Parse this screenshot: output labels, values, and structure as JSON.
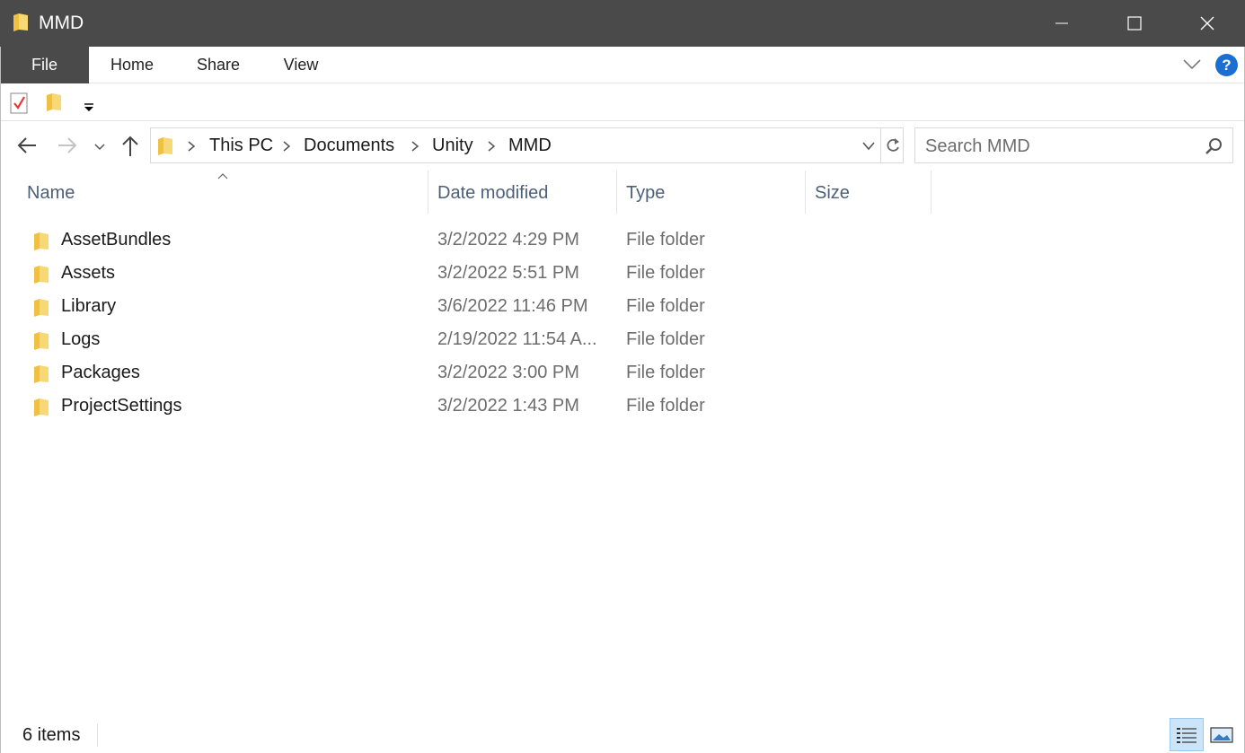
{
  "window": {
    "title": "MMD",
    "minimize_icon": "minimize-icon",
    "maximize_icon": "maximize-icon",
    "close_icon": "close-icon"
  },
  "ribbon": {
    "tabs": [
      {
        "label": "File",
        "active": true
      },
      {
        "label": "Home"
      },
      {
        "label": "Share"
      },
      {
        "label": "View"
      }
    ],
    "help_label": "?",
    "accent_color": "#1a6fd1"
  },
  "quick_access": {
    "icons": [
      "properties-icon",
      "new-folder-icon",
      "customize-dropdown-icon"
    ]
  },
  "navigation": {
    "breadcrumb": [
      "This PC",
      "Documents",
      "Unity",
      "MMD"
    ],
    "search_placeholder": "Search MMD"
  },
  "columns": [
    "Name",
    "Date modified",
    "Type",
    "Size"
  ],
  "files": [
    {
      "name": "AssetBundles",
      "date": "3/2/2022 4:29 PM",
      "type": "File folder"
    },
    {
      "name": "Assets",
      "date": "3/2/2022 5:51 PM",
      "type": "File folder"
    },
    {
      "name": "Library",
      "date": "3/6/2022 11:46 PM",
      "type": "File folder"
    },
    {
      "name": "Logs",
      "date": "2/19/2022 11:54 A...",
      "type": "File folder"
    },
    {
      "name": "Packages",
      "date": "3/2/2022 3:00 PM",
      "type": "File folder"
    },
    {
      "name": "ProjectSettings",
      "date": "3/2/2022 1:43 PM",
      "type": "File folder"
    }
  ],
  "status": {
    "item_count": "6 items"
  }
}
